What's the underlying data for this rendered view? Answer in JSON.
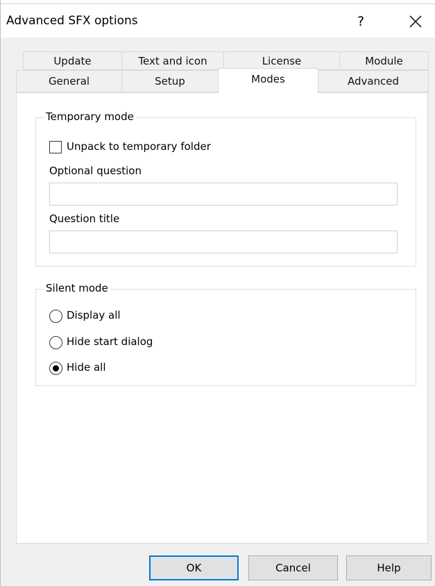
{
  "window": {
    "title": "Advanced SFX options",
    "help_label": "?"
  },
  "tabs": {
    "row1": [
      "Update",
      "Text and icon",
      "License",
      "Module"
    ],
    "row2": [
      "General",
      "Setup",
      "Modes",
      "Advanced"
    ],
    "active": "Modes"
  },
  "temporary_mode": {
    "legend": "Temporary mode",
    "unpack_label": "Unpack to temporary folder",
    "unpack_checked": false,
    "optional_question_label": "Optional question",
    "optional_question_value": "",
    "question_title_label": "Question title",
    "question_title_value": ""
  },
  "silent_mode": {
    "legend": "Silent mode",
    "options": [
      "Display all",
      "Hide start dialog",
      "Hide all"
    ],
    "selected": "Hide all"
  },
  "buttons": {
    "ok": "OK",
    "cancel": "Cancel",
    "help": "Help"
  },
  "icons": {
    "close": "close-icon",
    "help": "help-icon"
  },
  "colors": {
    "accent": "#0078d7",
    "dialog_bg": "#f0f0f0",
    "panel_bg": "#ffffff"
  }
}
